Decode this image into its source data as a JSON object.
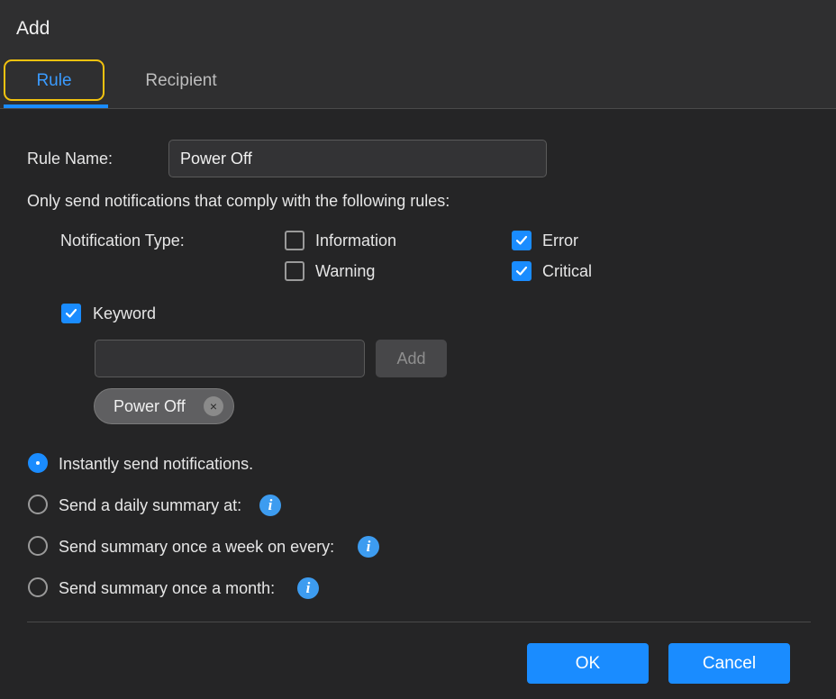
{
  "dialog": {
    "title": "Add"
  },
  "tabs": [
    {
      "label": "Rule",
      "active": true
    },
    {
      "label": "Recipient",
      "active": false
    }
  ],
  "rule_name": {
    "label": "Rule Name:",
    "value": "Power Off"
  },
  "rules_intro": "Only send notifications that comply with the following rules:",
  "notification_type": {
    "label": "Notification Type:",
    "options": [
      {
        "label": "Information",
        "checked": false
      },
      {
        "label": "Error",
        "checked": true
      },
      {
        "label": "Warning",
        "checked": false
      },
      {
        "label": "Critical",
        "checked": true
      }
    ]
  },
  "keyword": {
    "label": "Keyword",
    "checked": true,
    "input_value": "",
    "add_label": "Add",
    "tags": [
      {
        "label": "Power Off",
        "remove_glyph": "×"
      }
    ]
  },
  "schedule": {
    "options": [
      {
        "label": "Instantly send notifications.",
        "selected": true,
        "info": false
      },
      {
        "label": "Send a daily summary at:",
        "selected": false,
        "info": true
      },
      {
        "label": "Send summary once a week on every:",
        "selected": false,
        "info": true
      },
      {
        "label": "Send summary once a month:",
        "selected": false,
        "info": true
      }
    ],
    "info_glyph": "i"
  },
  "footer": {
    "ok_label": "OK",
    "cancel_label": "Cancel"
  },
  "colors": {
    "background": "#252526",
    "header": "#2f2f30",
    "accent": "#1a8cff",
    "tab_highlight": "#f2c20f",
    "info": "#3d9cf0"
  },
  "icons": {
    "checkbox_checked": "checkmark-icon",
    "info": "info-icon",
    "chip_remove": "close-icon"
  }
}
